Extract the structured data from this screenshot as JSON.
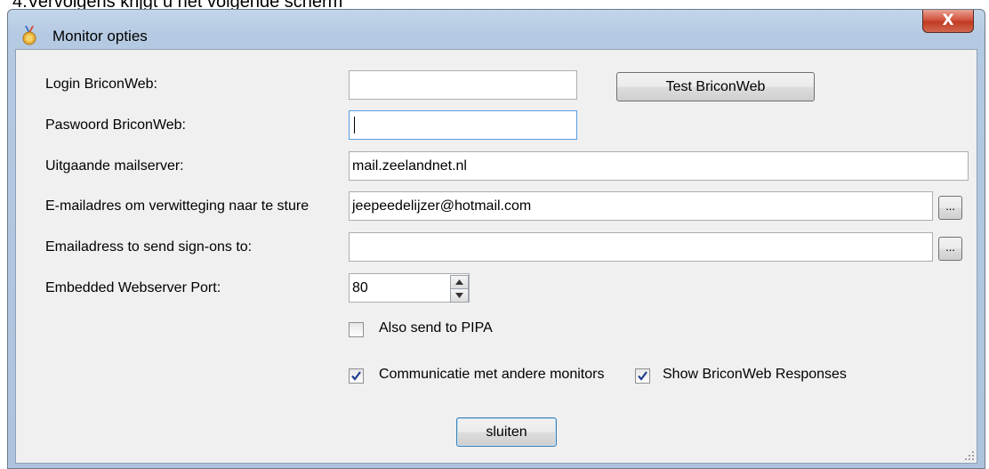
{
  "document": {
    "fragment_text": "4.Vervolgens krijgt u het volgende scherm"
  },
  "window": {
    "title": "Monitor opties",
    "close_label": "X",
    "icon": "medal-icon"
  },
  "form": {
    "login_label": "Login BriconWeb:",
    "login_value": "",
    "test_button": "Test BriconWeb",
    "password_label": "Paswoord BriconWeb:",
    "password_value": "",
    "mailserver_label": "Uitgaande mailserver:",
    "mailserver_value": "mail.zeelandnet.nl",
    "notify_email_label": "E-mailadres om verwitteging naar te sture",
    "notify_email_value": "jeepeedelijzer@hotmail.com",
    "notify_browse": "...",
    "signon_email_label": "Emailadress to send sign-ons to:",
    "signon_email_value": "",
    "signon_browse": "...",
    "port_label": "Embedded Webserver Port:",
    "port_value": "80",
    "pipa_label": "Also send to PIPA",
    "pipa_checked": false,
    "comm_label": "Communicatie met andere monitors",
    "comm_checked": true,
    "responses_label": "Show BriconWeb Responses",
    "responses_checked": true,
    "close_button": "sluiten"
  }
}
